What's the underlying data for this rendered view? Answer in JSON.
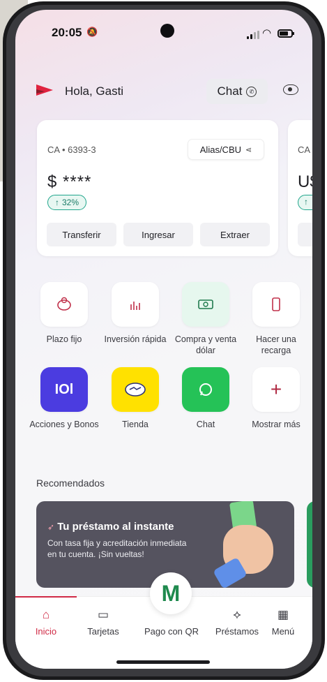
{
  "status": {
    "time": "20:05"
  },
  "header": {
    "greeting": "Hola, Gasti",
    "chat_label": "Chat"
  },
  "cards": [
    {
      "account": "CA • 6393-3",
      "alias_label": "Alias/CBU",
      "balance": "$ ****",
      "change": "32%",
      "actions": [
        "Transferir",
        "Ingresar",
        "Extraer"
      ]
    },
    {
      "account": "CA •",
      "balance": "U$"
    }
  ],
  "quick_actions": [
    {
      "label": "Plazo fijo",
      "icon": "piggy-bank-icon"
    },
    {
      "label": "Inversión rápida",
      "icon": "chart-bars-icon"
    },
    {
      "label": "Compra y venta dólar",
      "icon": "dollar-bill-icon"
    },
    {
      "label": "Hacer una recarga",
      "icon": "phone-recharge-icon"
    },
    {
      "label": "Acciones y Bonos",
      "icon": "iol-logo-icon",
      "text": "IOl"
    },
    {
      "label": "Tienda",
      "icon": "handshake-icon"
    },
    {
      "label": "Chat",
      "icon": "whatsapp-icon"
    },
    {
      "label": "Mostrar más",
      "icon": "plus-icon"
    }
  ],
  "recommended": {
    "title": "Recomendados",
    "promo_title": "Tu préstamo al instante",
    "promo_body": "Con tasa fija y acreditación inmediata en tu cuenta. ¡Sin vueltas!"
  },
  "nav": {
    "items": [
      "Inicio",
      "Tarjetas",
      "Pago con QR",
      "Préstamos",
      "Menú"
    ],
    "qr_letter": "M",
    "accent": "#d02a45"
  }
}
